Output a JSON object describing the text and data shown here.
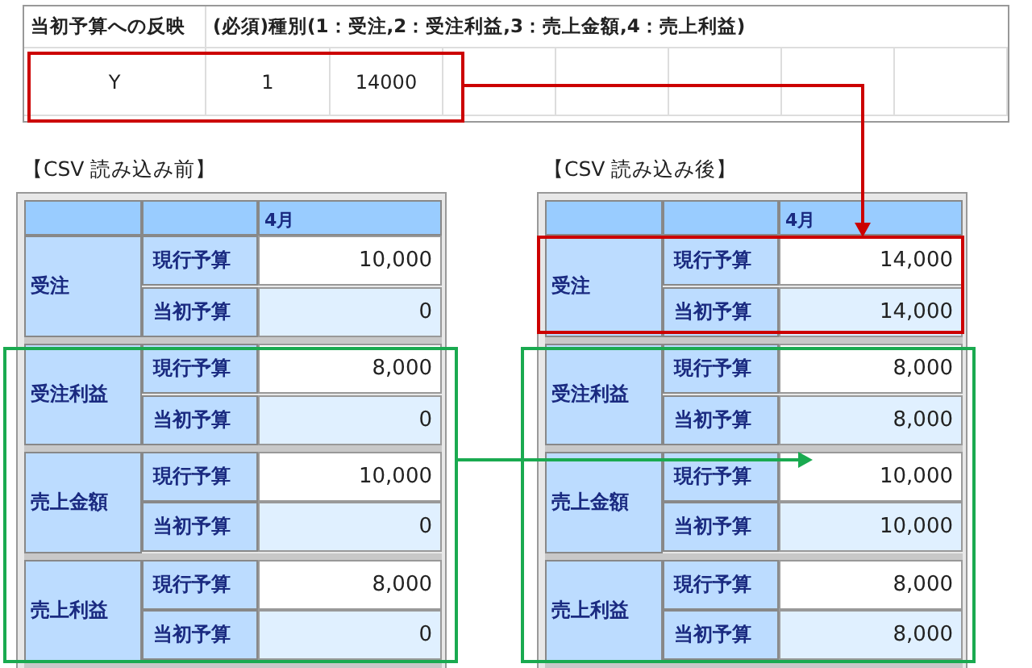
{
  "import_table": {
    "columns": [
      "当初予算への反映",
      "(必須)種別(1：受注,2：受注利益,3：売上金額,4：売上利益)"
    ],
    "row": [
      "Y",
      "1",
      "14000"
    ]
  },
  "panels": [
    {
      "title": "【CSV 読み込み前】",
      "month": "4月",
      "groups": [
        {
          "name": "受注",
          "rows": [
            {
              "kind": "current",
              "label": "現行予算",
              "value": "10,000"
            },
            {
              "kind": "initial",
              "label": "当初予算",
              "value": "0"
            }
          ]
        },
        {
          "name": "受注利益",
          "rows": [
            {
              "kind": "current",
              "label": "現行予算",
              "value": "8,000"
            },
            {
              "kind": "initial",
              "label": "当初予算",
              "value": "0"
            }
          ]
        },
        {
          "name": "売上金額",
          "rows": [
            {
              "kind": "current",
              "label": "現行予算",
              "value": "10,000"
            },
            {
              "kind": "initial",
              "label": "当初予算",
              "value": "0"
            }
          ]
        },
        {
          "name": "売上利益",
          "rows": [
            {
              "kind": "current",
              "label": "現行予算",
              "value": "8,000"
            },
            {
              "kind": "initial",
              "label": "当初予算",
              "value": "0"
            }
          ]
        }
      ]
    },
    {
      "title": "【CSV 読み込み後】",
      "month": "4月",
      "groups": [
        {
          "name": "受注",
          "rows": [
            {
              "kind": "current",
              "label": "現行予算",
              "value": "14,000"
            },
            {
              "kind": "initial",
              "label": "当初予算",
              "value": "14,000"
            }
          ]
        },
        {
          "name": "受注利益",
          "rows": [
            {
              "kind": "current",
              "label": "現行予算",
              "value": "8,000"
            },
            {
              "kind": "initial",
              "label": "当初予算",
              "value": "8,000"
            }
          ]
        },
        {
          "name": "売上金額",
          "rows": [
            {
              "kind": "current",
              "label": "現行予算",
              "value": "10,000"
            },
            {
              "kind": "initial",
              "label": "当初予算",
              "value": "10,000"
            }
          ]
        },
        {
          "name": "売上利益",
          "rows": [
            {
              "kind": "current",
              "label": "現行予算",
              "value": "8,000"
            },
            {
              "kind": "initial",
              "label": "当初予算",
              "value": "8,000"
            }
          ]
        }
      ]
    }
  ]
}
